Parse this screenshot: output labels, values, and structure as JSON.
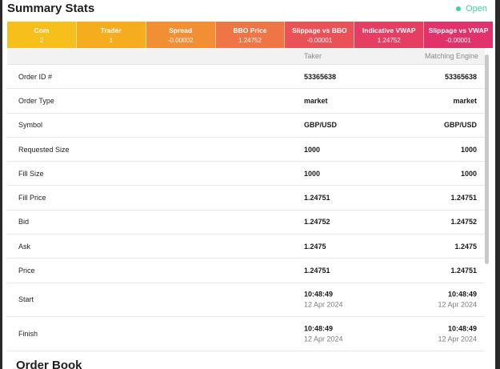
{
  "header": {
    "title": "Summary Stats",
    "status_label": "Open",
    "status_color": "#3fd39b"
  },
  "metrics": [
    {
      "label": "Com",
      "value": "2",
      "color": "#f7bf1b"
    },
    {
      "label": "Trader",
      "value": "1",
      "color": "#f6ac1f"
    },
    {
      "label": "Spread",
      "value": "-0.00002",
      "color": "#f28f35"
    },
    {
      "label": "BBO Price",
      "value": "1.24752",
      "color": "#ef7546"
    },
    {
      "label": "Slippage vs BBO",
      "value": "-0.00001",
      "color": "#eb5258"
    },
    {
      "label": "Indicative VWAP",
      "value": "1.24752",
      "color": "#e63e63"
    },
    {
      "label": "Slippage vs VWAP",
      "value": "-0.00001",
      "color": "#e2326c"
    }
  ],
  "table": {
    "columns": [
      "Taker",
      "Matching Engine"
    ],
    "rows": [
      {
        "label": "Order ID #",
        "taker": "53365638",
        "engine": "53365638"
      },
      {
        "label": "Order Type",
        "taker": "market",
        "engine": "market"
      },
      {
        "label": "Symbol",
        "taker": "GBP/USD",
        "engine": "GBP/USD"
      },
      {
        "label": "Requested Size",
        "taker": "1000",
        "engine": "1000"
      },
      {
        "label": "Fill Size",
        "taker": "1000",
        "engine": "1000"
      },
      {
        "label": "Fill Price",
        "taker": "1.24751",
        "engine": "1.24751"
      },
      {
        "label": "Bid",
        "taker": "1.24752",
        "engine": "1.24752"
      },
      {
        "label": "Ask",
        "taker": "1.2475",
        "engine": "1.2475"
      },
      {
        "label": "Price",
        "taker": "1.24751",
        "engine": "1.24751"
      },
      {
        "label": "Start",
        "taker": "10:48:49",
        "taker_sub": "12 Apr 2024",
        "engine": "10:48:49",
        "engine_sub": "12 Apr 2024"
      },
      {
        "label": "Finish",
        "taker": "10:48:49",
        "taker_sub": "12 Apr 2024",
        "engine": "10:48:49",
        "engine_sub": "12 Apr 2024"
      }
    ]
  },
  "next_section": {
    "title": "Order Book"
  }
}
